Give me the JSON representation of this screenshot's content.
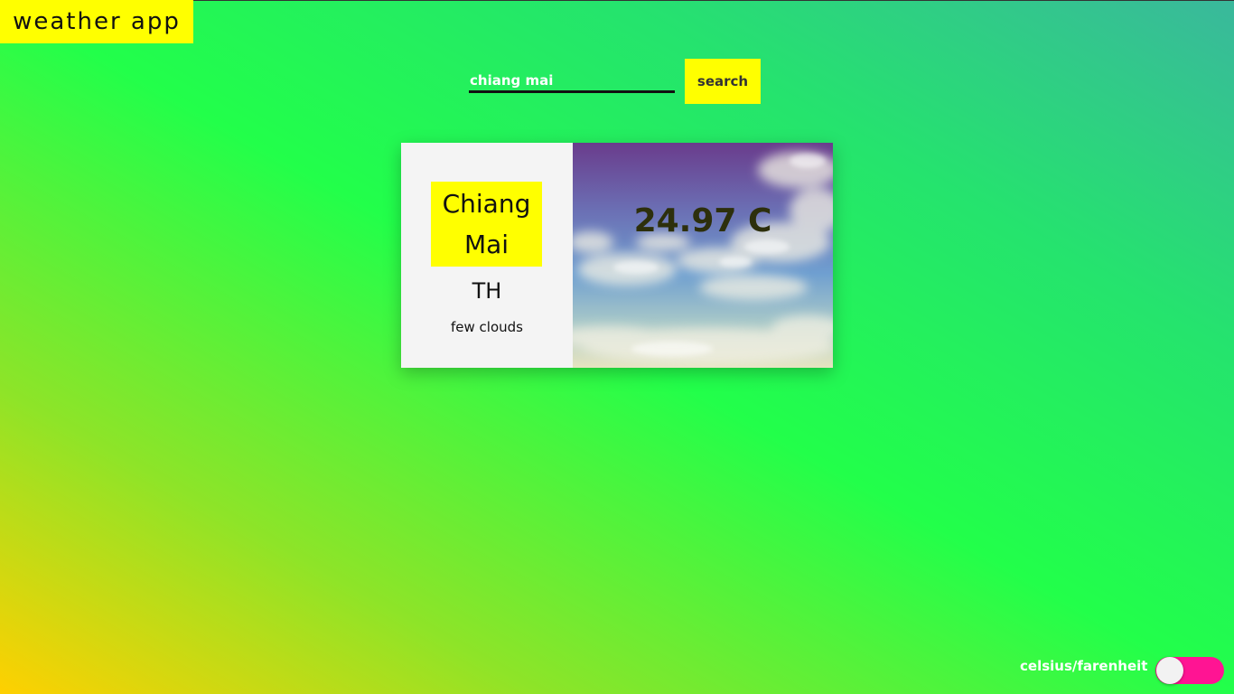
{
  "app": {
    "title": "weather app"
  },
  "search": {
    "value": "chiang mai",
    "placeholder": "",
    "button_label": "search"
  },
  "weather": {
    "city": "Chiang Mai",
    "country": "TH",
    "condition": "few clouds",
    "temperature": "24.97 C",
    "image_icon": "cloudy-sky-image"
  },
  "units_toggle": {
    "label": "celsius/farenheit",
    "state": "celsius"
  },
  "colors": {
    "accent_yellow": "#ffff00",
    "toggle_pink": "#ff1493",
    "card_panel": "#f4f4f4",
    "temperature_text": "#2d2f0c"
  }
}
